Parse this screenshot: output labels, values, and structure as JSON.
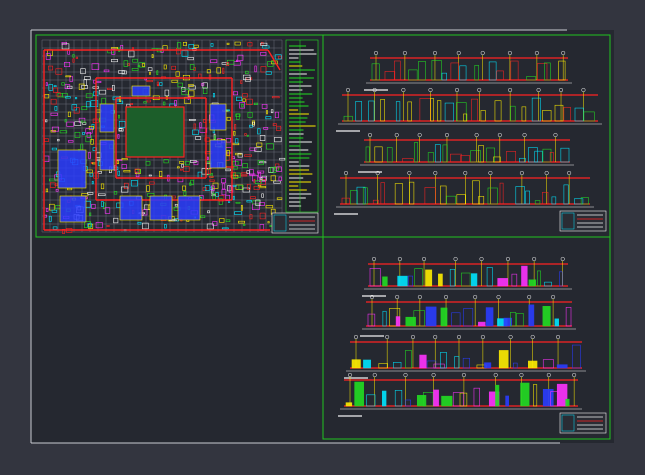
{
  "app": {
    "title": ""
  },
  "colors": {
    "model_space_bg": "#33353f",
    "sheet_bg": "#252830",
    "sheet_border": "#c9cbd2",
    "viewport_frame": "#21c41f",
    "cad_red": "#ff2222",
    "cad_yellow": "#ffee00",
    "cad_green": "#22dd22",
    "cad_cyan": "#00e5ff",
    "cad_blue": "#2a3cff",
    "cad_magenta": "#ff33ff",
    "cad_white": "#f2f2f2",
    "cad_grid": "#7a7f8a"
  },
  "drawing": {
    "viewports": [
      {
        "name": "floor-plan",
        "content": "plan"
      },
      {
        "name": "elevations-upper",
        "content": "elevations"
      },
      {
        "name": "sections-lower",
        "content": "sections"
      },
      {
        "name": "empty-area",
        "content": "none"
      }
    ],
    "upper_elevation_count": 4,
    "lower_section_count": 4
  }
}
